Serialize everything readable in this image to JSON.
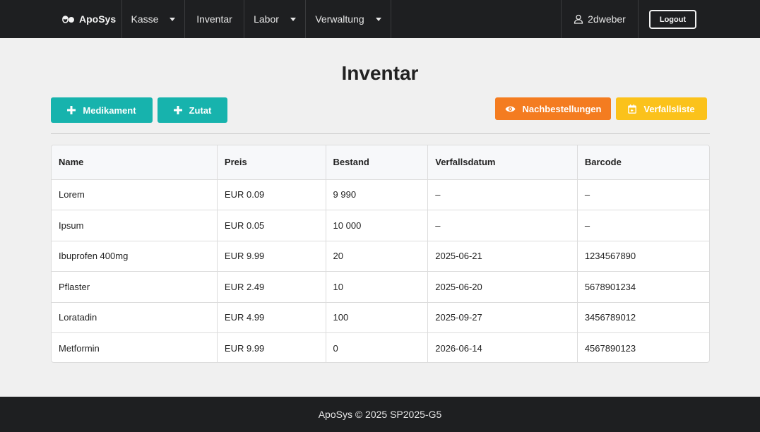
{
  "navbar": {
    "brand": "ApoSys",
    "items": [
      {
        "label": "Kasse",
        "dropdown": true
      },
      {
        "label": "Inventar",
        "dropdown": false
      },
      {
        "label": "Labor",
        "dropdown": true
      },
      {
        "label": "Verwaltung",
        "dropdown": true
      }
    ],
    "user": "2dweber",
    "logout": "Logout"
  },
  "page": {
    "title": "Inventar",
    "buttons": {
      "add_medication": "Medikament",
      "add_ingredient": "Zutat",
      "reorders": "Nachbestellungen",
      "expiry_list": "Verfallsliste"
    }
  },
  "table": {
    "headers": [
      "Name",
      "Preis",
      "Bestand",
      "Verfallsdatum",
      "Barcode"
    ],
    "rows": [
      [
        "Lorem",
        "EUR 0.09",
        "9 990",
        "–",
        "–"
      ],
      [
        "Ipsum",
        "EUR 0.05",
        "10 000",
        "–",
        "–"
      ],
      [
        "Ibuprofen 400mg",
        "EUR 9.99",
        "20",
        "2025-06-21",
        "1234567890"
      ],
      [
        "Pflaster",
        "EUR 2.49",
        "10",
        "2025-06-20",
        "5678901234"
      ],
      [
        "Loratadin",
        "EUR 4.99",
        "100",
        "2025-09-27",
        "3456789012"
      ],
      [
        "Metformin",
        "EUR 9.99",
        "0",
        "2026-06-14",
        "4567890123"
      ]
    ]
  },
  "footer": {
    "text": "ApoSys © 2025 SP2025-G5"
  },
  "colors": {
    "navbar_bg": "#1e1f21",
    "teal": "#17b3ad",
    "orange": "#f47c20",
    "yellow": "#fbc21b"
  }
}
